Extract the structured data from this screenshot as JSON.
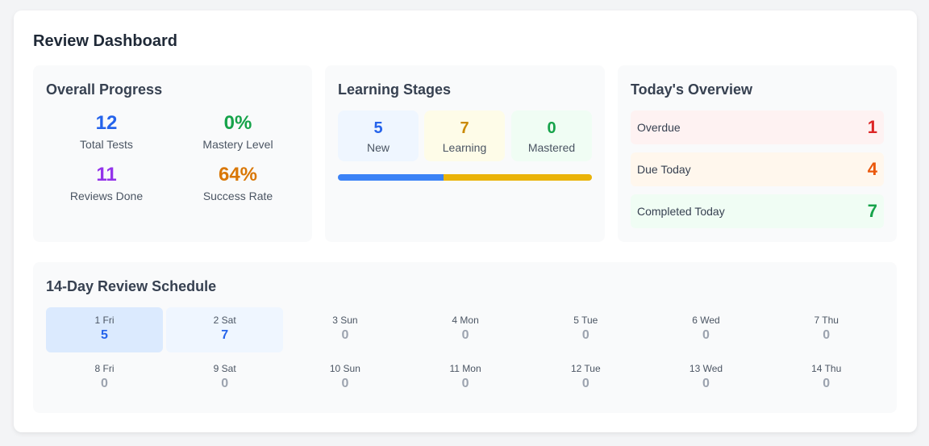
{
  "dashboard": {
    "title": "Review Dashboard"
  },
  "progress": {
    "title": "Overall Progress",
    "stats": [
      {
        "value": "12",
        "label": "Total Tests",
        "color": "#2563eb"
      },
      {
        "value": "0%",
        "label": "Mastery Level",
        "color": "#16a34a"
      },
      {
        "value": "11",
        "label": "Reviews Done",
        "color": "#9333ea"
      },
      {
        "value": "64%",
        "label": "Success Rate",
        "color": "#d97706"
      }
    ]
  },
  "stages": {
    "title": "Learning Stages",
    "items": [
      {
        "value": "5",
        "label": "New",
        "color": "#2563eb",
        "bg": "#eff6ff"
      },
      {
        "value": "7",
        "label": "Learning",
        "color": "#ca8a04",
        "bg": "#fefce8"
      },
      {
        "value": "0",
        "label": "Mastered",
        "color": "#16a34a",
        "bg": "#f0fdf4"
      }
    ],
    "bar_colors": [
      "#3b82f6",
      "#eab308",
      "#22c55e"
    ]
  },
  "today": {
    "title": "Today's Overview",
    "rows": [
      {
        "label": "Overdue",
        "value": "1",
        "color": "#dc2626",
        "bg": "#fef2f2"
      },
      {
        "label": "Due Today",
        "value": "4",
        "color": "#ea580c",
        "bg": "#fff7ed"
      },
      {
        "label": "Completed Today",
        "value": "7",
        "color": "#16a34a",
        "bg": "#f0fdf4"
      }
    ]
  },
  "schedule": {
    "title": "14-Day Review Schedule",
    "days": [
      {
        "label": "1 Fri",
        "value": "5"
      },
      {
        "label": "2 Sat",
        "value": "7"
      },
      {
        "label": "3 Sun",
        "value": "0"
      },
      {
        "label": "4 Mon",
        "value": "0"
      },
      {
        "label": "5 Tue",
        "value": "0"
      },
      {
        "label": "6 Wed",
        "value": "0"
      },
      {
        "label": "7 Thu",
        "value": "0"
      },
      {
        "label": "8 Fri",
        "value": "0"
      },
      {
        "label": "9 Sat",
        "value": "0"
      },
      {
        "label": "10 Sun",
        "value": "0"
      },
      {
        "label": "11 Mon",
        "value": "0"
      },
      {
        "label": "12 Tue",
        "value": "0"
      },
      {
        "label": "13 Wed",
        "value": "0"
      },
      {
        "label": "14 Thu",
        "value": "0"
      }
    ]
  }
}
